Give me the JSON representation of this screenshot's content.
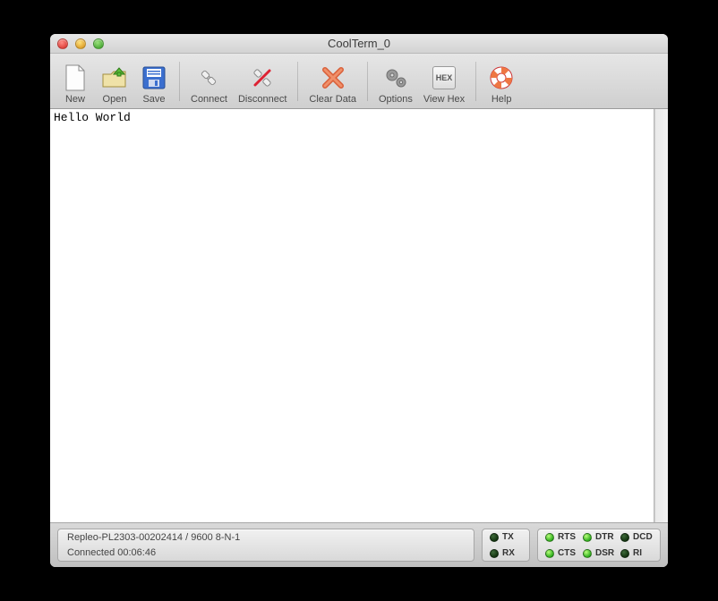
{
  "window": {
    "title": "CoolTerm_0"
  },
  "toolbar": {
    "new": "New",
    "open": "Open",
    "save": "Save",
    "connect": "Connect",
    "disconnect": "Disconnect",
    "clear": "Clear Data",
    "options": "Options",
    "viewhex": "View Hex",
    "viewhex_badge": "HEX",
    "help": "Help"
  },
  "terminal": {
    "content": "Hello World"
  },
  "status": {
    "port_line": "Repleo-PL2303-00202414 / 9600 8-N-1",
    "conn_line": "Connected 00:06:46"
  },
  "leds": {
    "tx": {
      "label": "TX",
      "on": false
    },
    "rx": {
      "label": "RX",
      "on": false
    },
    "rts": {
      "label": "RTS",
      "on": true
    },
    "cts": {
      "label": "CTS",
      "on": true
    },
    "dtr": {
      "label": "DTR",
      "on": true
    },
    "dsr": {
      "label": "DSR",
      "on": true
    },
    "dcd": {
      "label": "DCD",
      "on": false
    },
    "ri": {
      "label": "RI",
      "on": false
    }
  }
}
